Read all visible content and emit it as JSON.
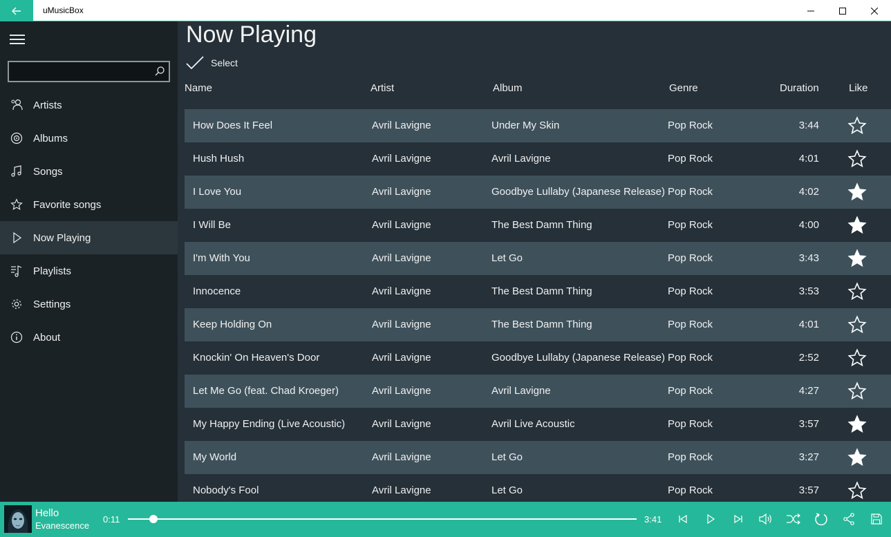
{
  "window": {
    "title": "uMusicBox"
  },
  "search": {
    "placeholder": ""
  },
  "nav": [
    {
      "label": "Artists",
      "icon": "artists-icon"
    },
    {
      "label": "Albums",
      "icon": "albums-icon"
    },
    {
      "label": "Songs",
      "icon": "songs-icon"
    },
    {
      "label": "Favorite songs",
      "icon": "star-icon"
    },
    {
      "label": "Now Playing",
      "icon": "play-icon",
      "active": true
    },
    {
      "label": "Playlists",
      "icon": "playlists-icon"
    },
    {
      "label": "Settings",
      "icon": "gear-icon"
    },
    {
      "label": "About",
      "icon": "info-icon"
    }
  ],
  "page": {
    "title": "Now Playing",
    "select_label": "Select"
  },
  "columns": {
    "name": "Name",
    "artist": "Artist",
    "album": "Album",
    "genre": "Genre",
    "duration": "Duration",
    "like": "Like"
  },
  "songs": [
    {
      "name": "How Does It Feel",
      "artist": "Avril Lavigne",
      "album": "Under My Skin",
      "genre": "Pop Rock",
      "duration": "3:44",
      "liked": false
    },
    {
      "name": "Hush Hush",
      "artist": "Avril Lavigne",
      "album": "Avril Lavigne",
      "genre": "Pop Rock",
      "duration": "4:01",
      "liked": false
    },
    {
      "name": "I Love You",
      "artist": "Avril Lavigne",
      "album": "Goodbye Lullaby (Japanese Release)",
      "genre": "Pop Rock",
      "duration": "4:02",
      "liked": true
    },
    {
      "name": "I Will Be",
      "artist": "Avril Lavigne",
      "album": "The Best Damn Thing",
      "genre": "Pop Rock",
      "duration": "4:00",
      "liked": true
    },
    {
      "name": "I'm With You",
      "artist": "Avril Lavigne",
      "album": "Let Go",
      "genre": "Pop Rock",
      "duration": "3:43",
      "liked": true
    },
    {
      "name": "Innocence",
      "artist": "Avril Lavigne",
      "album": "The Best Damn Thing",
      "genre": "Pop Rock",
      "duration": "3:53",
      "liked": false
    },
    {
      "name": "Keep Holding On",
      "artist": "Avril Lavigne",
      "album": "The Best Damn Thing",
      "genre": "Pop Rock",
      "duration": "4:01",
      "liked": false
    },
    {
      "name": "Knockin' On Heaven's Door",
      "artist": "Avril Lavigne",
      "album": "Goodbye Lullaby (Japanese Release)",
      "genre": "Pop Rock",
      "duration": "2:52",
      "liked": false
    },
    {
      "name": "Let Me Go (feat. Chad Kroeger)",
      "artist": "Avril Lavigne",
      "album": "Avril Lavigne",
      "genre": "Pop Rock",
      "duration": "4:27",
      "liked": false
    },
    {
      "name": "My Happy Ending (Live Acoustic)",
      "artist": "Avril Lavigne",
      "album": "Avril Live Acoustic",
      "genre": "Pop Rock",
      "duration": "3:57",
      "liked": true
    },
    {
      "name": "My World",
      "artist": "Avril Lavigne",
      "album": "Let Go",
      "genre": "Pop Rock",
      "duration": "3:27",
      "liked": true
    },
    {
      "name": "Nobody's Fool",
      "artist": "Avril Lavigne",
      "album": "Let Go",
      "genre": "Pop Rock",
      "duration": "3:57",
      "liked": false
    }
  ],
  "player": {
    "title": "Hello",
    "artist": "Evanescence",
    "elapsed": "0:11",
    "total": "3:41",
    "progress_fraction": 0.05
  },
  "colors": {
    "accent": "#26b89a",
    "sidebar": "#1a2226",
    "content": "#253038",
    "row_alt": "#3e515b"
  }
}
